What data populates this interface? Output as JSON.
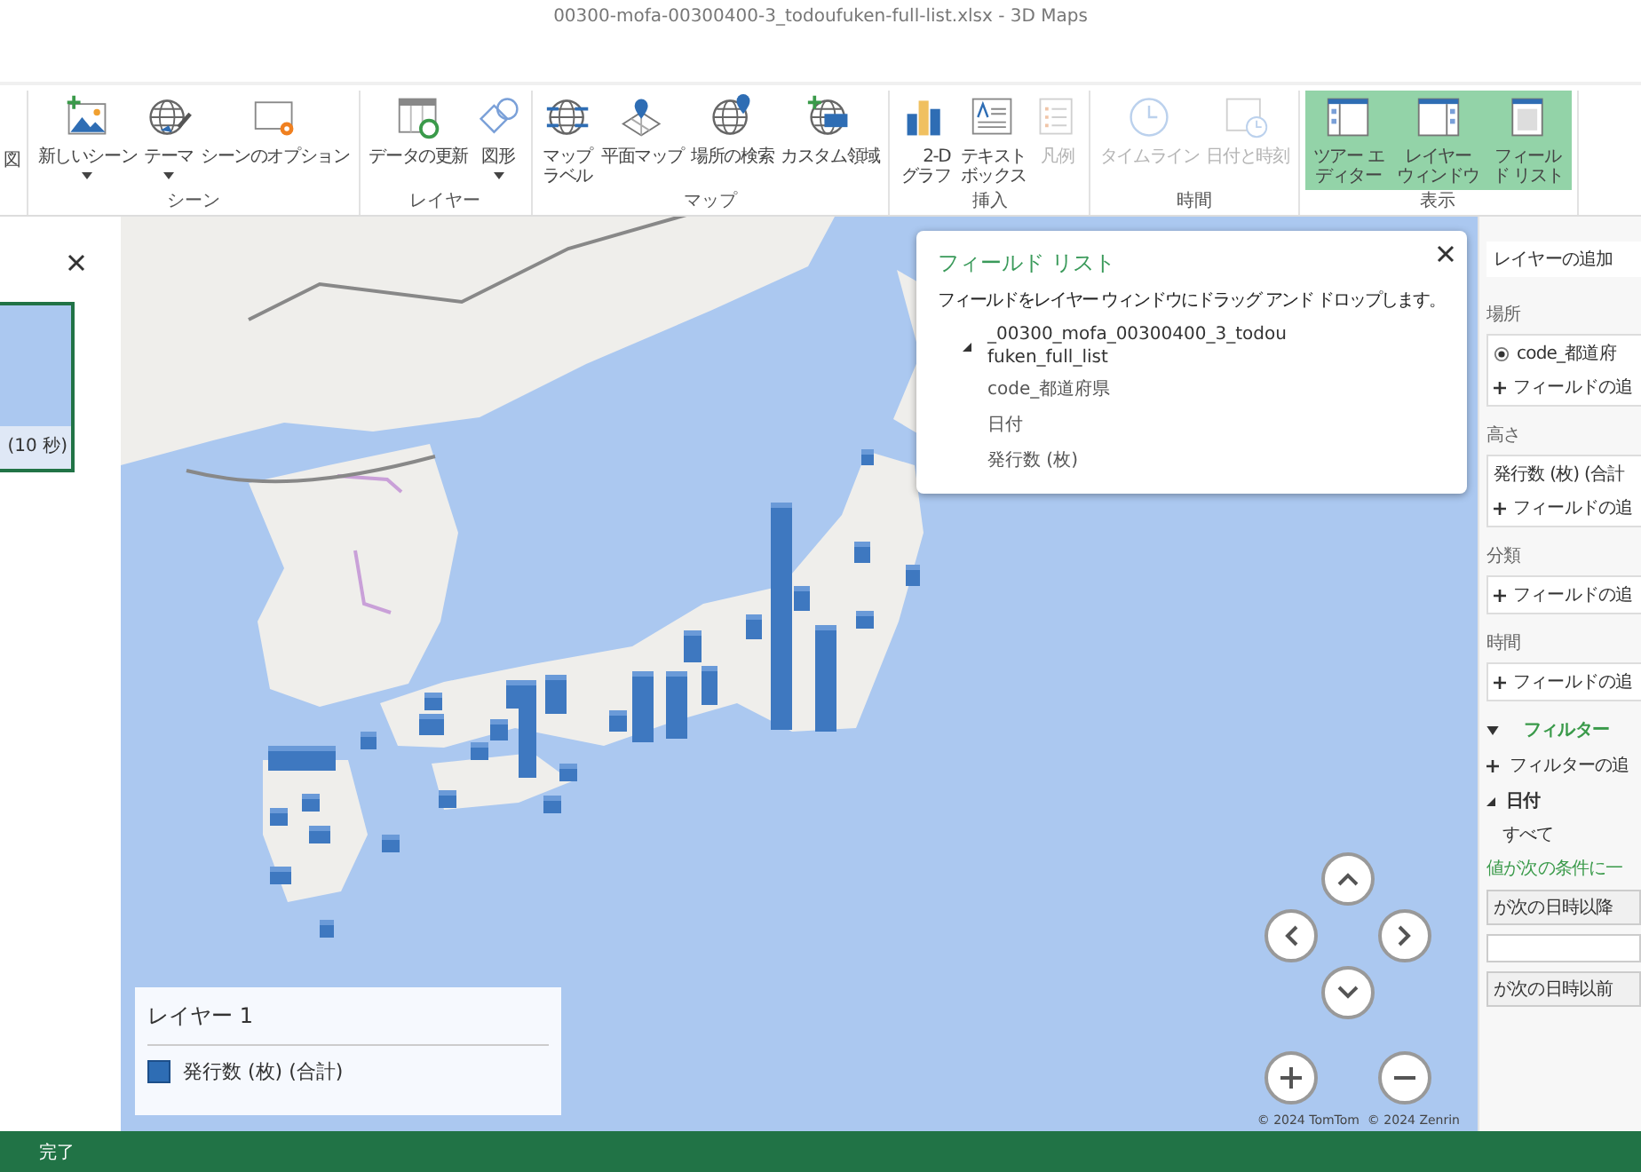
{
  "window": {
    "title": "00300-mofa-00300400-3_todoufuken-full-list.xlsx - 3D Maps"
  },
  "ribbon": {
    "groups": [
      {
        "buttons": [
          {
            "label": "図",
            "has_menu": false,
            "disabled": false,
            "selected": false
          }
        ]
      },
      {
        "label": "シーン",
        "buttons": [
          {
            "label": "新しいシーン",
            "has_menu": true,
            "disabled": false,
            "selected": false
          },
          {
            "label": "テーマ",
            "has_menu": true,
            "disabled": false,
            "selected": false
          },
          {
            "label": "シーンのオプション",
            "has_menu": false,
            "disabled": false,
            "selected": false
          }
        ]
      },
      {
        "label": "レイヤー",
        "buttons": [
          {
            "label": "データの更新",
            "has_menu": false,
            "disabled": false,
            "selected": false
          },
          {
            "label": "図形",
            "has_menu": true,
            "disabled": false,
            "selected": false
          }
        ]
      },
      {
        "label": "マップ",
        "buttons": [
          {
            "label": "マップラベル",
            "has_menu": false,
            "disabled": false,
            "selected": false
          },
          {
            "label": "平面マップ",
            "has_menu": false,
            "disabled": false,
            "selected": false
          },
          {
            "label": "場所の検索",
            "has_menu": false,
            "disabled": false,
            "selected": false
          },
          {
            "label": "カスタム領域",
            "has_menu": false,
            "disabled": false,
            "selected": false
          }
        ]
      },
      {
        "label": "挿入",
        "buttons": [
          {
            "label": "2-Dグラフ",
            "has_menu": false,
            "disabled": false,
            "selected": false
          },
          {
            "label": "テキストボックス",
            "has_menu": false,
            "disabled": false,
            "selected": false
          },
          {
            "label": "凡例",
            "has_menu": false,
            "disabled": true,
            "selected": false
          }
        ]
      },
      {
        "label": "時間",
        "buttons": [
          {
            "label": "タイムライン",
            "has_menu": false,
            "disabled": true,
            "selected": false
          },
          {
            "label": "日付と時刻",
            "has_menu": false,
            "disabled": true,
            "selected": false
          }
        ]
      },
      {
        "label": "表示",
        "buttons": [
          {
            "label": "ツアー エディター",
            "has_menu": false,
            "disabled": false,
            "selected": true
          },
          {
            "label": "レイヤーウィンドウ",
            "has_menu": false,
            "disabled": false,
            "selected": true
          },
          {
            "label": "フィールド リスト",
            "has_menu": false,
            "disabled": false,
            "selected": true
          }
        ]
      }
    ]
  },
  "tour_panel": {
    "scenes": [
      {
        "duration": "(10 秒)",
        "selected": true
      }
    ]
  },
  "field_list": {
    "title": "フィールド リスト",
    "instructions": "フィールドをレイヤー ウィンドウにドラッグ アンド ドロップします。",
    "tables": [
      {
        "name": "_00300_mofa_00300400_3_todoufuken_full_list",
        "expanded": true,
        "children": [
          {
            "name": "code_都道府県"
          },
          {
            "name": "日付"
          },
          {
            "name": "発行数 (枚)"
          }
        ]
      }
    ]
  },
  "legend": {
    "title": "レイヤー 1",
    "items": [
      {
        "label": "発行数 (枚) (合計)"
      }
    ]
  },
  "map": {
    "copyright": "© 2024 TomTom  © 2024 Zenrin"
  },
  "layer_pane": {
    "add_layer": "レイヤーの追加",
    "sections": [
      {
        "heading": "場所",
        "fields": [
          {
            "kind": "radio",
            "label": "code_都道府",
            "selected": true
          },
          {
            "kind": "add",
            "label": "フィールドの追"
          }
        ]
      },
      {
        "heading": "高さ",
        "fields": [
          {
            "kind": "plain",
            "label": "発行数 (枚) (合計"
          },
          {
            "kind": "add",
            "label": "フィールドの追"
          }
        ]
      },
      {
        "heading": "分類",
        "fields": [
          {
            "kind": "add",
            "label": "フィールドの追"
          }
        ]
      },
      {
        "heading": "時間",
        "fields": [
          {
            "kind": "add",
            "label": "フィールドの追"
          }
        ]
      }
    ],
    "filters": {
      "heading": "フィルター",
      "expanded": true,
      "add": "フィルターの追",
      "items": [
        {
          "name": "日付",
          "expanded": true,
          "value": "すべて",
          "condition_label": "値が次の条件に一",
          "conditions": [
            {
              "kind": "dropdown",
              "value": "が次の日時以降"
            },
            {
              "kind": "input"
            },
            {
              "kind": "dropdown",
              "value": "が次の日時以前"
            }
          ]
        }
      ]
    }
  },
  "status_bar": {
    "text": "完了"
  }
}
